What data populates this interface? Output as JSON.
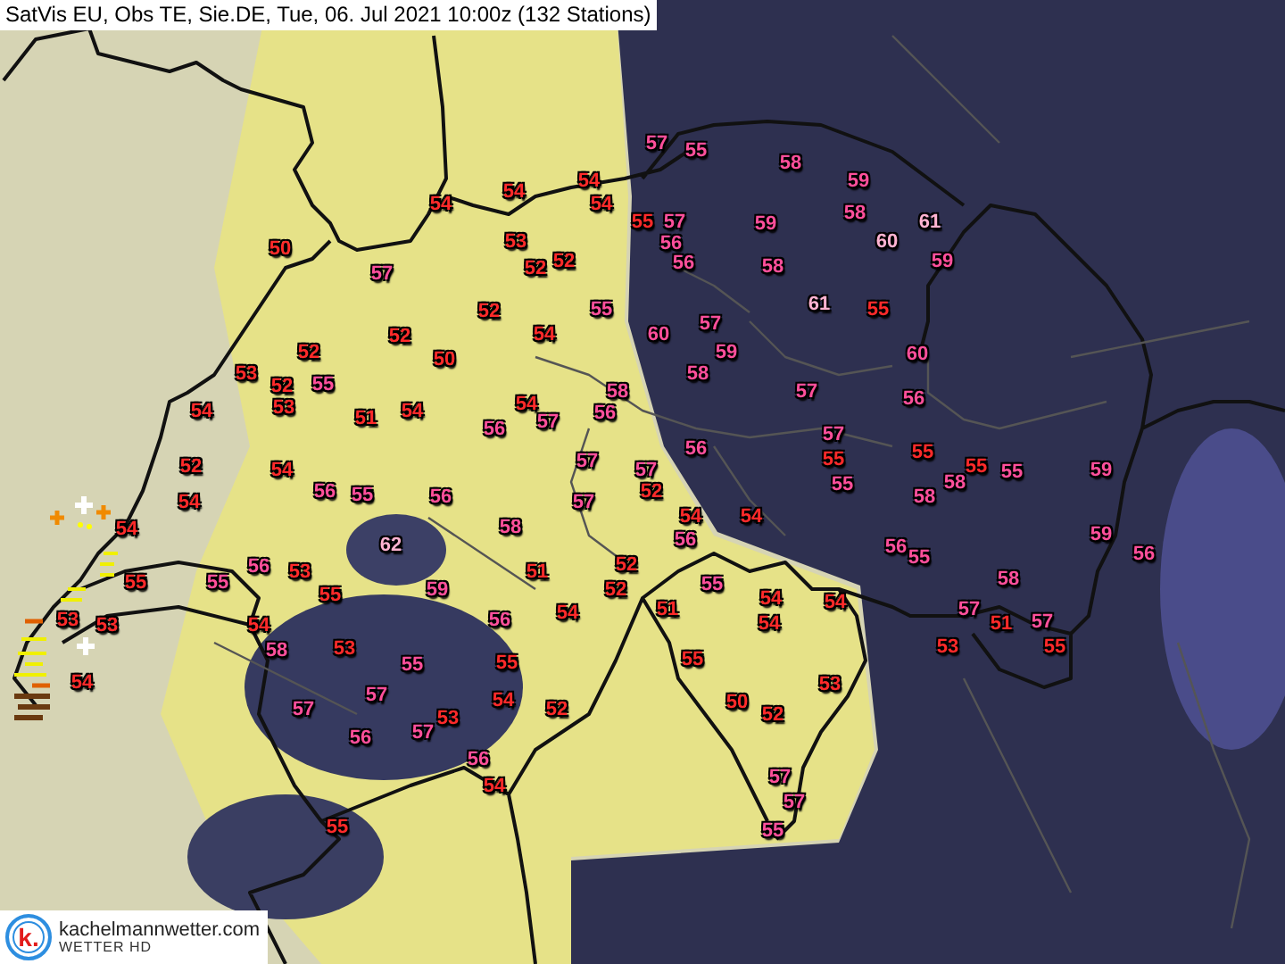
{
  "title": "SatVis EU, Obs TE, Sie.DE, Tue, 06. Jul 2021 10:00z (132 Stations)",
  "stations": [
    {
      "value": "54",
      "color": "#ff2a2a"
    },
    {
      "value": "54",
      "color": "#ff2a2a"
    },
    {
      "value": "54",
      "color": "#ff2a2a"
    },
    {
      "value": "54",
      "color": "#ff2a2a"
    },
    {
      "value": "55",
      "color": "#ff2a2a"
    },
    {
      "value": "57",
      "color": "#ff4f9b"
    },
    {
      "value": "56",
      "color": "#ff4f9b"
    },
    {
      "value": "56",
      "color": "#ff4f9b"
    },
    {
      "value": "57",
      "color": "#ff4f9b"
    },
    {
      "value": "55",
      "color": "#ff4f9b"
    },
    {
      "value": "58",
      "color": "#ff4f9b"
    },
    {
      "value": "59",
      "color": "#ff4f9b"
    },
    {
      "value": "58",
      "color": "#ff4f9b"
    },
    {
      "value": "61",
      "color": "#ffb3d1"
    },
    {
      "value": "60",
      "color": "#ffb3d1"
    },
    {
      "value": "59",
      "color": "#ff4f9b"
    },
    {
      "value": "59",
      "color": "#ff4f9b"
    },
    {
      "value": "58",
      "color": "#ff4f9b"
    },
    {
      "value": "61",
      "color": "#ffb3d1"
    },
    {
      "value": "55",
      "color": "#ff2a2a"
    },
    {
      "value": "60",
      "color": "#ff4f9b"
    },
    {
      "value": "50",
      "color": "#ff2a2a"
    },
    {
      "value": "57",
      "color": "#ff4f9b"
    },
    {
      "value": "53",
      "color": "#ff2a2a"
    },
    {
      "value": "52",
      "color": "#ff2a2a"
    },
    {
      "value": "52",
      "color": "#ff2a2a"
    },
    {
      "value": "52",
      "color": "#ff2a2a"
    },
    {
      "value": "55",
      "color": "#ff4f9b"
    },
    {
      "value": "60",
      "color": "#ff4f9b"
    },
    {
      "value": "57",
      "color": "#ff4f9b"
    },
    {
      "value": "59",
      "color": "#ff4f9b"
    },
    {
      "value": "58",
      "color": "#ff4f9b"
    },
    {
      "value": "57",
      "color": "#ff4f9b"
    },
    {
      "value": "56",
      "color": "#ff4f9b"
    },
    {
      "value": "52",
      "color": "#ff2a2a"
    },
    {
      "value": "50",
      "color": "#ff2a2a"
    },
    {
      "value": "54",
      "color": "#ff2a2a"
    },
    {
      "value": "53",
      "color": "#ff2a2a"
    },
    {
      "value": "52",
      "color": "#ff2a2a"
    },
    {
      "value": "52",
      "color": "#ff2a2a"
    },
    {
      "value": "55",
      "color": "#ff4f9b"
    },
    {
      "value": "54",
      "color": "#ff2a2a"
    },
    {
      "value": "53",
      "color": "#ff2a2a"
    },
    {
      "value": "51",
      "color": "#ff2a2a"
    },
    {
      "value": "54",
      "color": "#ff2a2a"
    },
    {
      "value": "54",
      "color": "#ff2a2a"
    },
    {
      "value": "56",
      "color": "#ff4f9b"
    },
    {
      "value": "57",
      "color": "#ff4f9b"
    },
    {
      "value": "58",
      "color": "#ff4f9b"
    },
    {
      "value": "56",
      "color": "#ff4f9b"
    },
    {
      "value": "52",
      "color": "#ff2a2a"
    },
    {
      "value": "54",
      "color": "#ff2a2a"
    },
    {
      "value": "54",
      "color": "#ff2a2a"
    },
    {
      "value": "56",
      "color": "#ff4f9b"
    },
    {
      "value": "55",
      "color": "#ff4f9b"
    },
    {
      "value": "56",
      "color": "#ff4f9b"
    },
    {
      "value": "58",
      "color": "#ff4f9b"
    },
    {
      "value": "57",
      "color": "#ff4f9b"
    },
    {
      "value": "57",
      "color": "#ff4f9b"
    },
    {
      "value": "57",
      "color": "#ff4f9b"
    },
    {
      "value": "52",
      "color": "#ff2a2a"
    },
    {
      "value": "56",
      "color": "#ff4f9b"
    },
    {
      "value": "57",
      "color": "#ff4f9b"
    },
    {
      "value": "55",
      "color": "#ff2a2a"
    },
    {
      "value": "55",
      "color": "#ff4f9b"
    },
    {
      "value": "55",
      "color": "#ff2a2a"
    },
    {
      "value": "55",
      "color": "#ff2a2a"
    },
    {
      "value": "55",
      "color": "#ff4f9b"
    },
    {
      "value": "58",
      "color": "#ff4f9b"
    },
    {
      "value": "58",
      "color": "#ff4f9b"
    },
    {
      "value": "59",
      "color": "#ff4f9b"
    },
    {
      "value": "54",
      "color": "#ff2a2a"
    },
    {
      "value": "54",
      "color": "#ff2a2a"
    },
    {
      "value": "56",
      "color": "#ff4f9b"
    },
    {
      "value": "55",
      "color": "#ff4f9b"
    },
    {
      "value": "56",
      "color": "#ff4f9b"
    },
    {
      "value": "55",
      "color": "#ff4f9b"
    },
    {
      "value": "58",
      "color": "#ff4f9b"
    },
    {
      "value": "59",
      "color": "#ff4f9b"
    },
    {
      "value": "56",
      "color": "#ff4f9b"
    },
    {
      "value": "57",
      "color": "#ff4f9b"
    },
    {
      "value": "51",
      "color": "#ff2a2a"
    },
    {
      "value": "57",
      "color": "#ff4f9b"
    },
    {
      "value": "53",
      "color": "#ff2a2a"
    },
    {
      "value": "55",
      "color": "#ff2a2a"
    },
    {
      "value": "51",
      "color": "#ff2a2a"
    },
    {
      "value": "54",
      "color": "#ff2a2a"
    },
    {
      "value": "54",
      "color": "#ff2a2a"
    },
    {
      "value": "54",
      "color": "#ff2a2a"
    },
    {
      "value": "55",
      "color": "#ff2a2a"
    },
    {
      "value": "54",
      "color": "#ff2a2a"
    },
    {
      "value": "62",
      "color": "#ffb3d1"
    },
    {
      "value": "56",
      "color": "#ff4f9b"
    },
    {
      "value": "53",
      "color": "#ff2a2a"
    },
    {
      "value": "55",
      "color": "#ff2a2a"
    },
    {
      "value": "55",
      "color": "#ff4f9b"
    },
    {
      "value": "55",
      "color": "#ff2a2a"
    },
    {
      "value": "59",
      "color": "#ff4f9b"
    },
    {
      "value": "51",
      "color": "#ff2a2a"
    },
    {
      "value": "52",
      "color": "#ff2a2a"
    },
    {
      "value": "52",
      "color": "#ff2a2a"
    },
    {
      "value": "56",
      "color": "#ff4f9b"
    },
    {
      "value": "54",
      "color": "#ff2a2a"
    },
    {
      "value": "53",
      "color": "#ff2a2a"
    },
    {
      "value": "53",
      "color": "#ff2a2a"
    },
    {
      "value": "54",
      "color": "#ff2a2a"
    },
    {
      "value": "58",
      "color": "#ff4f9b"
    },
    {
      "value": "53",
      "color": "#ff2a2a"
    },
    {
      "value": "55",
      "color": "#ff4f9b"
    },
    {
      "value": "55",
      "color": "#ff2a2a"
    },
    {
      "value": "57",
      "color": "#ff4f9b"
    },
    {
      "value": "57",
      "color": "#ff4f9b"
    },
    {
      "value": "54",
      "color": "#ff2a2a"
    },
    {
      "value": "52",
      "color": "#ff2a2a"
    },
    {
      "value": "53",
      "color": "#ff2a2a"
    },
    {
      "value": "57",
      "color": "#ff4f9b"
    },
    {
      "value": "56",
      "color": "#ff4f9b"
    },
    {
      "value": "56",
      "color": "#ff4f9b"
    },
    {
      "value": "54",
      "color": "#ff2a2a"
    },
    {
      "value": "54",
      "color": "#ff2a2a"
    },
    {
      "value": "55",
      "color": "#ff2a2a"
    },
    {
      "value": "53",
      "color": "#ff2a2a"
    },
    {
      "value": "50",
      "color": "#ff2a2a"
    },
    {
      "value": "52",
      "color": "#ff2a2a"
    },
    {
      "value": "57",
      "color": "#ff4f9b"
    },
    {
      "value": "57",
      "color": "#ff4f9b"
    },
    {
      "value": "55",
      "color": "#ff4f9b"
    }
  ],
  "logo": {
    "mark": "k.",
    "name": "kachelmannwetter.com",
    "tagline": "WETTER HD"
  }
}
